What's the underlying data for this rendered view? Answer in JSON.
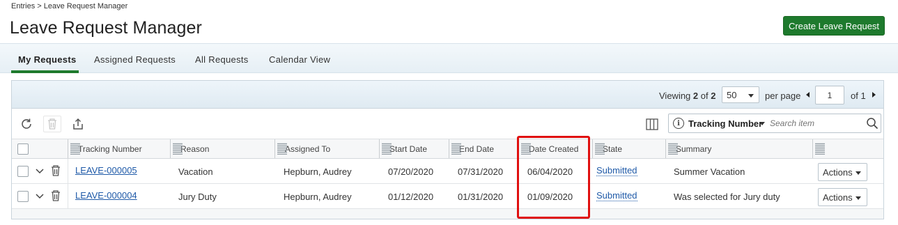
{
  "breadcrumb": "Entries > Leave Request Manager",
  "page_title": "Leave Request Manager",
  "create_button": "Create Leave Request",
  "tabs": [
    {
      "label": "My Requests",
      "active": true
    },
    {
      "label": "Assigned Requests",
      "active": false
    },
    {
      "label": "All Requests",
      "active": false
    },
    {
      "label": "Calendar View",
      "active": false
    }
  ],
  "pager": {
    "viewing_label": "Viewing",
    "viewing_count": "2",
    "of_label": "of",
    "total": "2",
    "page_size": "50",
    "per_page_label": "per page",
    "page_number": "1",
    "page_of_label": "of",
    "total_pages": "1"
  },
  "search": {
    "field": "Tracking Number",
    "placeholder": "Search item"
  },
  "columns": [
    "Tracking Number",
    "Reason",
    "Assigned To",
    "Start Date",
    "End Date",
    "Date Created",
    "State",
    "Summary"
  ],
  "rows": [
    {
      "tracking": "LEAVE-000005",
      "reason": "Vacation",
      "assigned_to": "Hepburn, Audrey",
      "start": "07/20/2020",
      "end": "07/31/2020",
      "created": "06/04/2020",
      "state": "Submitted",
      "summary": "Summer Vacation",
      "actions": "Actions"
    },
    {
      "tracking": "LEAVE-000004",
      "reason": "Jury Duty",
      "assigned_to": "Hepburn, Audrey",
      "start": "01/12/2020",
      "end": "01/31/2020",
      "created": "01/09/2020",
      "state": "Submitted",
      "summary": "Was selected for Jury duty",
      "actions": "Actions"
    }
  ],
  "colors": {
    "primary_green": "#1e7a2d",
    "link_blue": "#1f5aa8",
    "highlight_red": "#e01010"
  }
}
